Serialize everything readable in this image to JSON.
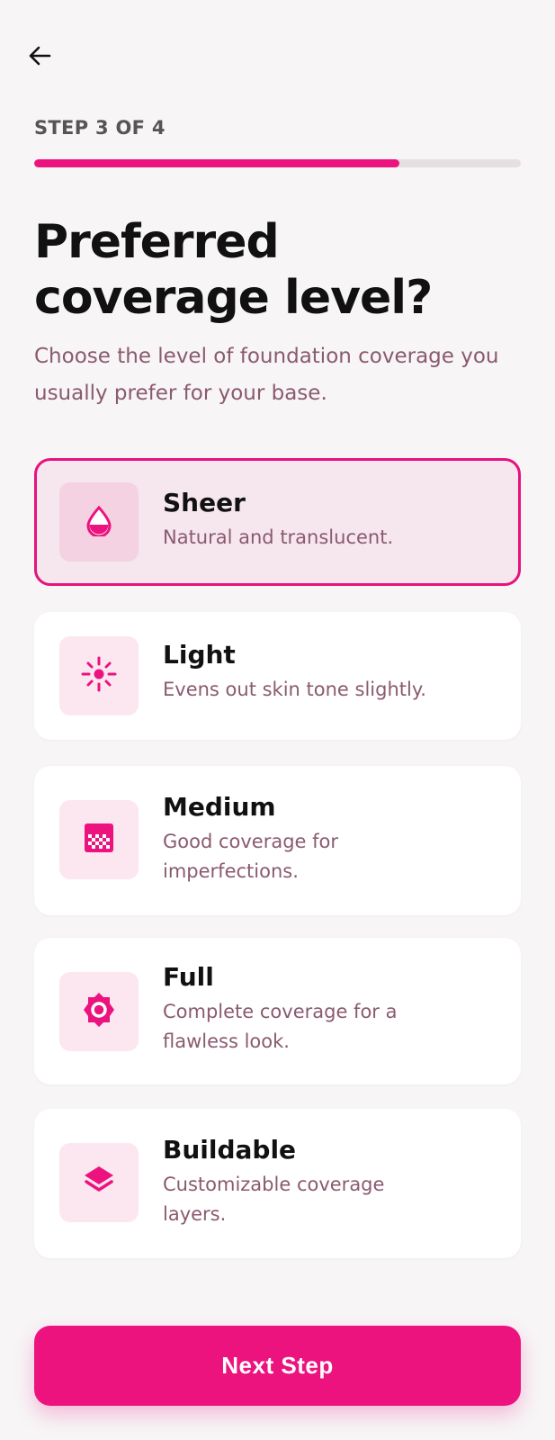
{
  "header": {
    "back_icon": "arrow-left-icon",
    "step_label": "STEP 3 OF 4",
    "progress_fraction": 0.75
  },
  "title": "Preferred coverage level?",
  "subtitle": "Choose the level of foundation coverage you usually prefer for your base.",
  "options": [
    {
      "title": "Sheer",
      "description": "Natural and translucent.",
      "icon": "water-drop-icon",
      "selected": true
    },
    {
      "title": "Light",
      "description": "Evens out skin tone slightly.",
      "icon": "sparkle-icon",
      "selected": false
    },
    {
      "title": "Medium",
      "description": "Good coverage for imperfections.",
      "icon": "texture-grid-icon",
      "selected": false
    },
    {
      "title": "Full",
      "description": "Complete coverage for a flawless look.",
      "icon": "badge-gear-icon",
      "selected": false
    },
    {
      "title": "Buildable",
      "description": "Customizable coverage layers.",
      "icon": "layers-icon",
      "selected": false
    }
  ],
  "next_button": {
    "label": "Next Step"
  },
  "colors": {
    "accent": "#ec137f",
    "background": "#f7f5f6",
    "muted_text": "#8a5a6f",
    "selected_card_bg": "#f6e6ee"
  }
}
